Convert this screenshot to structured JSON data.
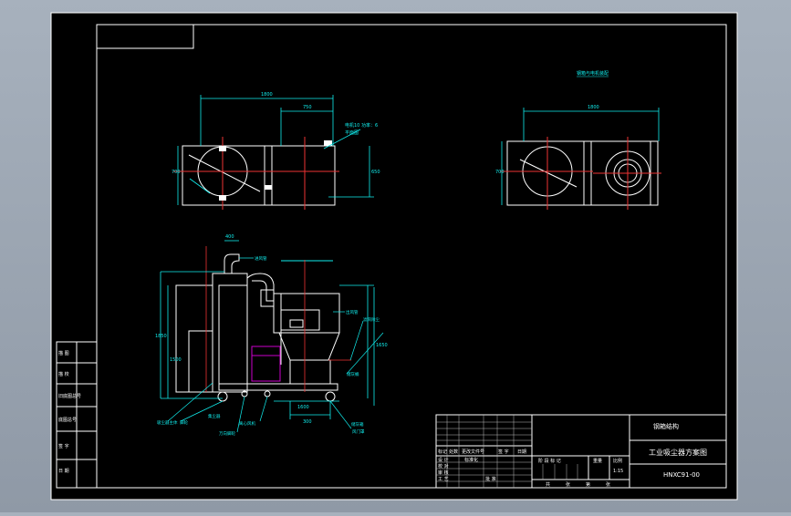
{
  "drawing": {
    "title": "工业吸尘器方案图",
    "drawing_no": "HNXC91-00",
    "company": "钢箱结构",
    "scale": "1:15",
    "top_view_label": "钢箱与电机装配",
    "title_block_headers": [
      "标记",
      "处数",
      "更改文件号",
      "签 字",
      "日期"
    ],
    "title_block_roles": [
      "设 计",
      "校 对",
      "审 核",
      "工 艺"
    ],
    "title_block_sig": "标准化",
    "title_block_approve": "批 准",
    "stage_label": "阶 段 标 记",
    "weight_label": "重量",
    "scale_label": "比例",
    "sheet_info": [
      "共",
      "张",
      "第",
      "张"
    ],
    "left_strip": [
      "描 图",
      "描 校",
      "旧底图总号",
      "底图总号",
      "签 字",
      "日 期"
    ],
    "annotations": [
      "电机10 功率：6",
      "平面图",
      "进风管",
      "出风管",
      "滤筒除尘",
      "储灰箱",
      "风门罩",
      "储灰桶",
      "吸尘器主体",
      "脚轮",
      "万向脚轮",
      "离心风机",
      "集尘器"
    ],
    "dimensions": {
      "top_left_overall": "1800",
      "top_left_sub": "750",
      "top_left_height": "700",
      "top_left_height2": "650",
      "top_right_overall": "1800",
      "top_right_height": "700",
      "side_top": "400",
      "side_left": "1850",
      "side_left2": "1500",
      "side_right": "1650",
      "side_bottom": "300",
      "side_bottom2": "1600"
    }
  }
}
